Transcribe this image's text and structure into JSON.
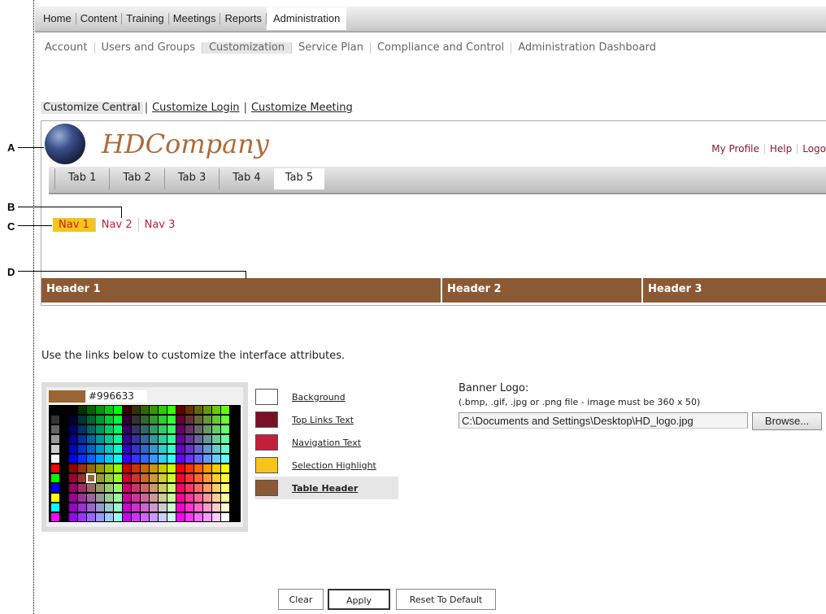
{
  "topmenu": [
    "Home",
    "Content",
    "Training",
    "Meetings",
    "Reports",
    "Administration"
  ],
  "submenu": [
    "Account",
    "Users and Groups",
    "Customization",
    "Service Plan",
    "Compliance and Control",
    "Administration Dashboard"
  ],
  "customize_links": {
    "central": "Customize Central",
    "login": "Customize Login",
    "meeting": "Customize Meeting"
  },
  "preview": {
    "company": "HDCompany",
    "toplinks": [
      "My Profile",
      "Help",
      "Logo"
    ],
    "tabs": [
      "Tab 1",
      "Tab 2",
      "Tab 3",
      "Tab 4",
      "Tab 5"
    ],
    "navs": [
      "Nav 1",
      "Nav 2",
      "Nav 3"
    ],
    "headers": [
      "Header 1",
      "Header 2",
      "Header 3"
    ]
  },
  "callouts": [
    "A",
    "B",
    "C",
    "D"
  ],
  "instructions": "Use the links below to customize the interface attributes.",
  "picker": {
    "current_hex": "#996633"
  },
  "attributes": [
    {
      "label": "Background",
      "color": "#ffffff"
    },
    {
      "label": "Top Links Text",
      "color": "#7a1028"
    },
    {
      "label": "Navigation Text",
      "color": "#c0203a"
    },
    {
      "label": "Selection Highlight",
      "color": "#f5c518"
    },
    {
      "label": "Table Header",
      "color": "#8b5a35"
    }
  ],
  "banner": {
    "title": "Banner Logo:",
    "note": "(.bmp, .gif, .jpg or .png file - image must be 360 x 50)",
    "file_value": "C:\\Documents and Settings\\Desktop\\HD_logo.jpg",
    "browse_label": "Browse..."
  },
  "buttons": {
    "clear": "Clear",
    "apply": "Apply",
    "reset": "Reset To Default"
  }
}
